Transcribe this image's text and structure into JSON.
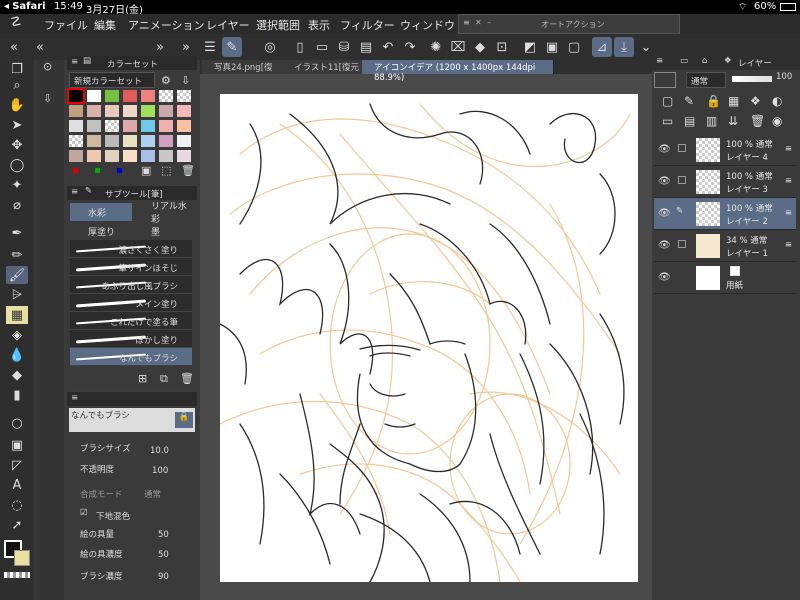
{
  "status_bar": {
    "carrier": "Safari",
    "time": "15:49",
    "date": "3月27日(金)",
    "battery": "60%"
  },
  "menu": [
    "ファイル",
    "編集",
    "アニメーション",
    "レイヤー",
    "選択範囲",
    "表示",
    "フィルター",
    "ウィンドウ"
  ],
  "auto_action": {
    "title": "オートアクション"
  },
  "color_set": {
    "title": "カラーセット",
    "set_name": "新規カラーセット"
  },
  "sub_tool": {
    "title": "サブツール[筆]",
    "tabs": [
      "水彩",
      "リアル水彩",
      "厚塗り",
      "墨"
    ],
    "brushes": [
      "濃さくさく塗り",
      "筆サインほそじ",
      "あぶり出し風ブラシ",
      "メイン塗り",
      "これだけで塗る筆",
      "ぼかし塗り",
      "なんでもブラシ"
    ]
  },
  "tool_property": {
    "name": "なんでもブラシ",
    "brush_size_label": "ブラシサイズ",
    "brush_size": "10.0",
    "opacity_label": "不透明度",
    "opacity": "100",
    "blend_label": "合成モード",
    "blend": "通常",
    "ground_label": "下地混色",
    "paint_amount_label": "絵の具量",
    "paint_amount": "50",
    "paint_density_label": "絵の具濃度",
    "paint_density": "50",
    "brush_density_label": "ブラシ濃度",
    "brush_density": "90"
  },
  "doc_tabs": [
    "写真24.png[復",
    "イラスト11[復元",
    "アイコンイデア (1200 x 1400px 144dpi 88.9%)"
  ],
  "layers": {
    "title": "レイヤー",
    "blend": "通常",
    "opacity": "100",
    "rows": [
      {
        "pct": "100 % 通常",
        "name": "レイヤー 4"
      },
      {
        "pct": "100 % 通常",
        "name": "レイヤー 3"
      },
      {
        "pct": "100 % 通常",
        "name": "レイヤー 2"
      },
      {
        "pct": "34 % 通常",
        "name": "レイヤー 1"
      },
      {
        "pct": "",
        "name": "用紙"
      }
    ]
  },
  "colors": {
    "accent": "#5b6c86",
    "sketch": "#f2c28a",
    "line": "#2a2a2a"
  }
}
